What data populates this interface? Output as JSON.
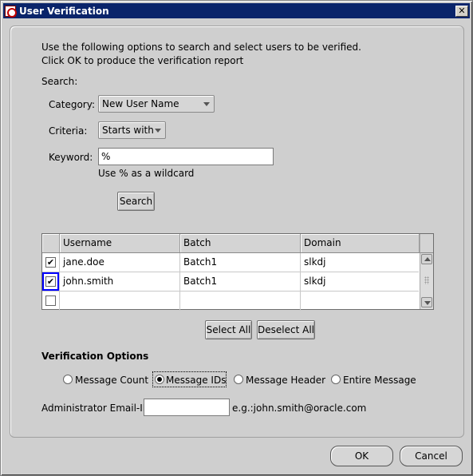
{
  "window": {
    "title": "User Verification",
    "close_glyph": "✕"
  },
  "intro": {
    "line1": "Use the following options to search and select users to be verified.",
    "line2": "Click OK to produce the verification report"
  },
  "search": {
    "heading": "Search:",
    "category_label": "Category:",
    "category_value": "New User Name",
    "criteria_label": "Criteria:",
    "criteria_value": "Starts with",
    "keyword_label": "Keyword:",
    "keyword_value": "%",
    "wildcard_hint": "Use % as a wildcard",
    "search_button": "Search"
  },
  "table": {
    "columns": [
      "Username",
      "Batch",
      "Domain"
    ],
    "rows": [
      {
        "checked": true,
        "username": "jane.doe",
        "batch": "Batch1",
        "domain": "slkdj"
      },
      {
        "checked": true,
        "username": "john.smith",
        "batch": "Batch1",
        "domain": "slkdj"
      },
      {
        "checked": false,
        "username": "",
        "batch": "",
        "domain": ""
      }
    ],
    "check_glyph": "✔"
  },
  "selection": {
    "select_all": "Select All",
    "deselect_all": "Deselect All"
  },
  "verification": {
    "heading": "Verification Options",
    "options": [
      "Message Count",
      "Message IDs",
      "Message Header",
      "Entire Message"
    ],
    "selected": "Message IDs",
    "admin_email_label": "Administrator Email-ID",
    "admin_email_value": "",
    "admin_email_hint": "e.g.:john.smith@oracle.com"
  },
  "footer": {
    "ok": "OK",
    "cancel": "Cancel"
  }
}
